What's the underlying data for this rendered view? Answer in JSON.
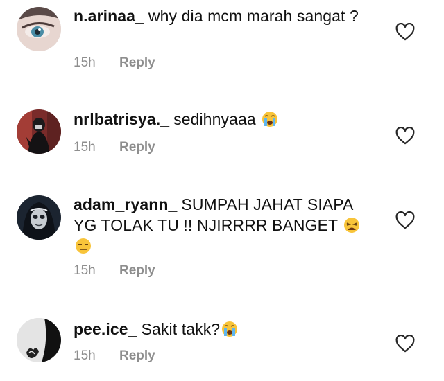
{
  "comments": [
    {
      "username": "n.arinaa_",
      "text": "why dia mcm marah sangat ?",
      "emojis": [],
      "time": "15h",
      "reply": "Reply",
      "like_icon": "heart-outline-icon"
    },
    {
      "username": "nrlbatrisya._",
      "text": "sedihnyaaa",
      "emojis": [
        "loudly-crying-face"
      ],
      "time": "15h",
      "reply": "Reply",
      "like_icon": "heart-outline-icon"
    },
    {
      "username": "adam_ryann_",
      "text": "SUMPAH JAHAT SIAPA YG TOLAK TU !! NJIRRRR BANGET",
      "emojis": [
        "weary-face",
        "expressionless-face"
      ],
      "time": "15h",
      "reply": "Reply",
      "like_icon": "heart-outline-icon"
    },
    {
      "username": "pee.ice_",
      "text": "Sakit takk?",
      "emojis": [
        "loudly-crying-face"
      ],
      "time": "15h",
      "reply": "Reply",
      "like_icon": "heart-outline-icon"
    }
  ],
  "colors": {
    "text": "#111111",
    "meta": "#8e8e8e",
    "icon": "#262626"
  }
}
